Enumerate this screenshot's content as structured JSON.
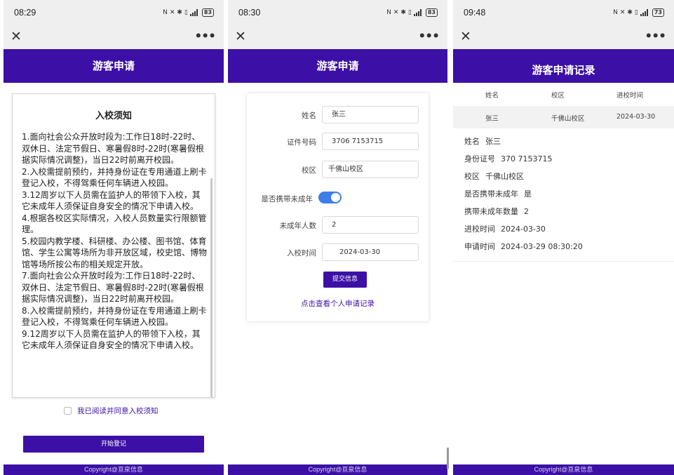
{
  "panels": [
    {
      "status_time": "08:29",
      "battery": "83",
      "title": "游客申请",
      "notice": {
        "title": "入校须知",
        "paragraphs": [
          "1.面向社会公众开放时段为:工作日18时-22时、双休日、法定节假日、寒暑假8时-22时(寒暑假根据实际情况调整)，当日22时前离开校园。",
          "2.入校需提前预约，并持身份证在专用通道上刷卡登记入校，不得驾乘任何车辆进入校园。",
          "3.12周岁以下人员需在监护人的带领下入校，其它未成年人须保证自身安全的情况下申请入校。",
          "4.根据各校区实际情况，入校人员数量实行限额管理。",
          "5.校园内教学楼、科研楼、办公楼、图书馆、体育馆、学生公寓等场所为非开放区域，校史馆、博物馆等场所按公布的相关规定开放。",
          "7.面向社会公众开放时段为:工作日18时-22时、双休日、法定节假日、寒暑假8时-22时(寒暑假根据实际情况调整)，当日22时前离开校园。",
          "8.入校需提前预约，并持身份证在专用通道上刷卡登记入校，不得驾乘任何车辆进入校园。",
          "9.12周岁以下人员需在监护人的带领下入校，其它未成年人须保证自身安全的情况下申请入校。"
        ]
      },
      "agree_label": "我已阅读并同意入校须知",
      "start_button": "开始登记",
      "footer": "Copyright@亘泉信息"
    },
    {
      "status_time": "08:30",
      "battery": "83",
      "title": "游客申请",
      "form": {
        "name_label": "姓名",
        "name_value": "张三",
        "id_label": "证件号码",
        "id_value": "3706          7153715",
        "campus_label": "校区",
        "campus_value": "千佛山校区",
        "minor_label": "是否携带未成年",
        "minor_count_label": "未成年人数",
        "minor_count_value": "2",
        "date_label": "入校时间",
        "date_value": "2024-03-30",
        "submit_label": "提交信息",
        "records_link": "点击查看个人申请记录"
      },
      "footer": "Copyright@亘泉信息"
    },
    {
      "status_time": "09:48",
      "battery": "73",
      "title": "游客申请记录",
      "table": {
        "headers": [
          "姓名",
          "校区",
          "进校时间"
        ],
        "row": [
          "张三",
          "千佛山校区",
          "2024-03-30"
        ]
      },
      "details": [
        {
          "label": "姓名",
          "value": "张三"
        },
        {
          "label": "身份证号",
          "value": "370         7153715"
        },
        {
          "label": "校区",
          "value": "千佛山校区"
        },
        {
          "label": "是否携带未成年",
          "value": "是"
        },
        {
          "label": "携带未成年数量",
          "value": "2"
        },
        {
          "label": "进校时间",
          "value": "2024-03-30"
        },
        {
          "label": "申请时间",
          "value": "2024-03-29 08:30:20"
        }
      ],
      "footer": "Copyright@亘泉信息"
    }
  ],
  "colors": {
    "brand": "#3c10a6",
    "toggle_on": "#3d7ee8",
    "statusbar_bg": "#efefef"
  },
  "icons": [
    "close-icon",
    "more-icon",
    "signal-icon",
    "wifi-icon",
    "bluetooth-icon",
    "vibrate-icon",
    "battery-icon"
  ]
}
